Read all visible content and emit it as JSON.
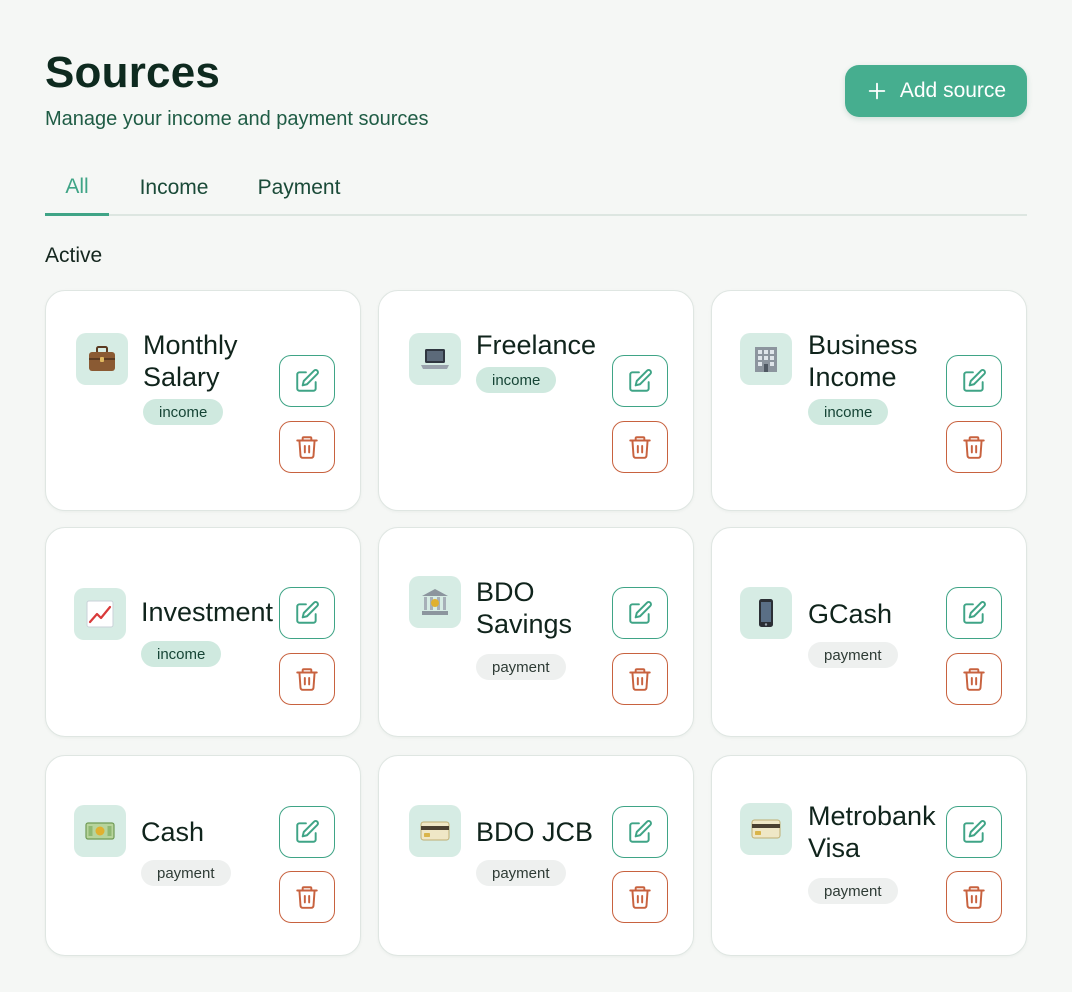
{
  "header": {
    "title": "Sources",
    "subtitle": "Manage your income and payment sources",
    "add_label": "Add source"
  },
  "tabs": [
    {
      "label": "All",
      "active": true
    },
    {
      "label": "Income",
      "active": false
    },
    {
      "label": "Payment",
      "active": false
    }
  ],
  "section_label": "Active",
  "colors": {
    "accent": "#46ae8f",
    "edit_outline": "#3fa486",
    "delete_outline": "#c8623f",
    "income_badge": "#cfe9df",
    "payment_badge": "#eef0ef"
  },
  "sources": [
    {
      "name": "Monthly Salary",
      "type": "income",
      "icon": "briefcase-icon"
    },
    {
      "name": "Freelance",
      "type": "income",
      "icon": "laptop-icon"
    },
    {
      "name": "Business Income",
      "type": "income",
      "icon": "office-building-icon"
    },
    {
      "name": "Investment",
      "type": "income",
      "icon": "chart-up-icon"
    },
    {
      "name": "BDO Savings",
      "type": "payment",
      "icon": "bank-icon"
    },
    {
      "name": "GCash",
      "type": "payment",
      "icon": "mobile-phone-icon"
    },
    {
      "name": "Cash",
      "type": "payment",
      "icon": "cash-icon"
    },
    {
      "name": "BDO JCB",
      "type": "payment",
      "icon": "credit-card-icon"
    },
    {
      "name": "Metrobank Visa",
      "type": "payment",
      "icon": "credit-card-icon"
    }
  ]
}
